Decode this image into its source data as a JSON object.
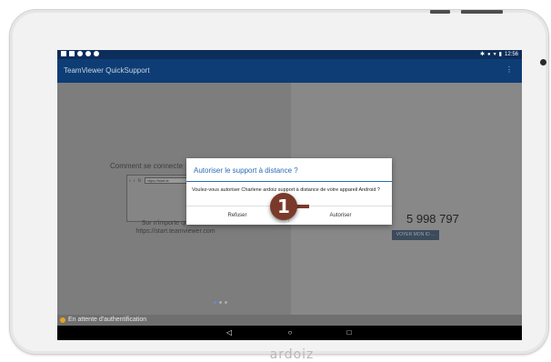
{
  "device": {
    "brand": "ardoiz"
  },
  "statusbar": {
    "time": "12:56"
  },
  "app": {
    "title": "TeamViewer QuickSupport",
    "menu_icon": "more-vertical-icon"
  },
  "main": {
    "connect_heading": "Comment se connecte",
    "browser_url": "https://start.te",
    "help_line1": "Sur n'importe quel autre",
    "help_line2": "https://start.teamviewer.com",
    "id_number": "5 998 797",
    "send_id_button": "VOYER MON ID ..."
  },
  "dialog": {
    "title": "Autoriser le support à distance ?",
    "body_prefix": "Voulez-vous autoriser ",
    "requester": "Charlene ardoiz",
    "body_suffix": " support à distance de votre appareil Android ?",
    "refuse_label": "Refuser",
    "allow_label": "Autoriser"
  },
  "pager": {
    "count": 3,
    "active": 0
  },
  "auth_status": {
    "text": "En attente d'authentification",
    "color": "#e3a51c"
  },
  "annotation": {
    "step": "1",
    "color": "#7a3a2a"
  },
  "colors": {
    "status_bar": "#0d2d5a",
    "app_bar": "#0e3d75",
    "dialog_accent": "#2d6bb5"
  }
}
